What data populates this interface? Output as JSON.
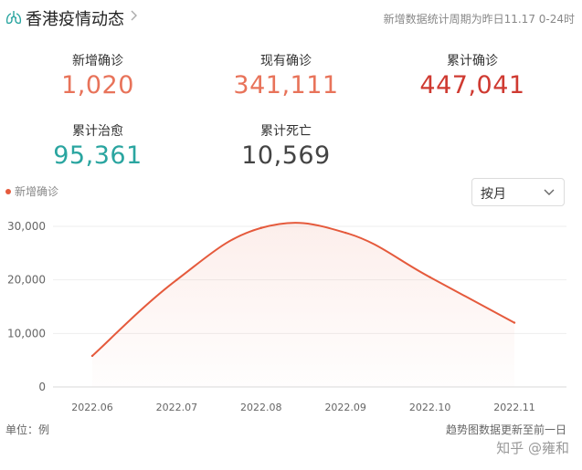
{
  "header": {
    "title": "香港疫情动态",
    "period_note": "新增数据统计周期为昨日11.17 0-24时"
  },
  "stats": [
    {
      "label": "新增确诊",
      "value": "1,020",
      "color": "#e8735a"
    },
    {
      "label": "现有确诊",
      "value": "341,111",
      "color": "#e8735a"
    },
    {
      "label": "累计确诊",
      "value": "447,041",
      "color": "#cf3a31"
    },
    {
      "label": "累计治愈",
      "value": "95,361",
      "color": "#2aa5a0"
    },
    {
      "label": "累计死亡",
      "value": "10,569",
      "color": "#444444"
    }
  ],
  "legend_label": "新增确诊",
  "period_select": {
    "value": "按月"
  },
  "chart_data": {
    "type": "line",
    "categories": [
      "2022.06",
      "2022.07",
      "2022.08",
      "2022.09",
      "2022.10",
      "2022.11"
    ],
    "series": [
      {
        "name": "新增确诊",
        "values": [
          5800,
          20000,
          29700,
          28800,
          20500,
          12000
        ],
        "color": "#e55a3c"
      }
    ],
    "yticks": [
      "0",
      "10,000",
      "20,000",
      "30,000"
    ],
    "ylim": [
      0,
      30000
    ],
    "grid": true
  },
  "footer": {
    "unit": "单位：例",
    "note": "趋势图数据更新至前一日"
  },
  "watermark": "知乎 @雍和"
}
